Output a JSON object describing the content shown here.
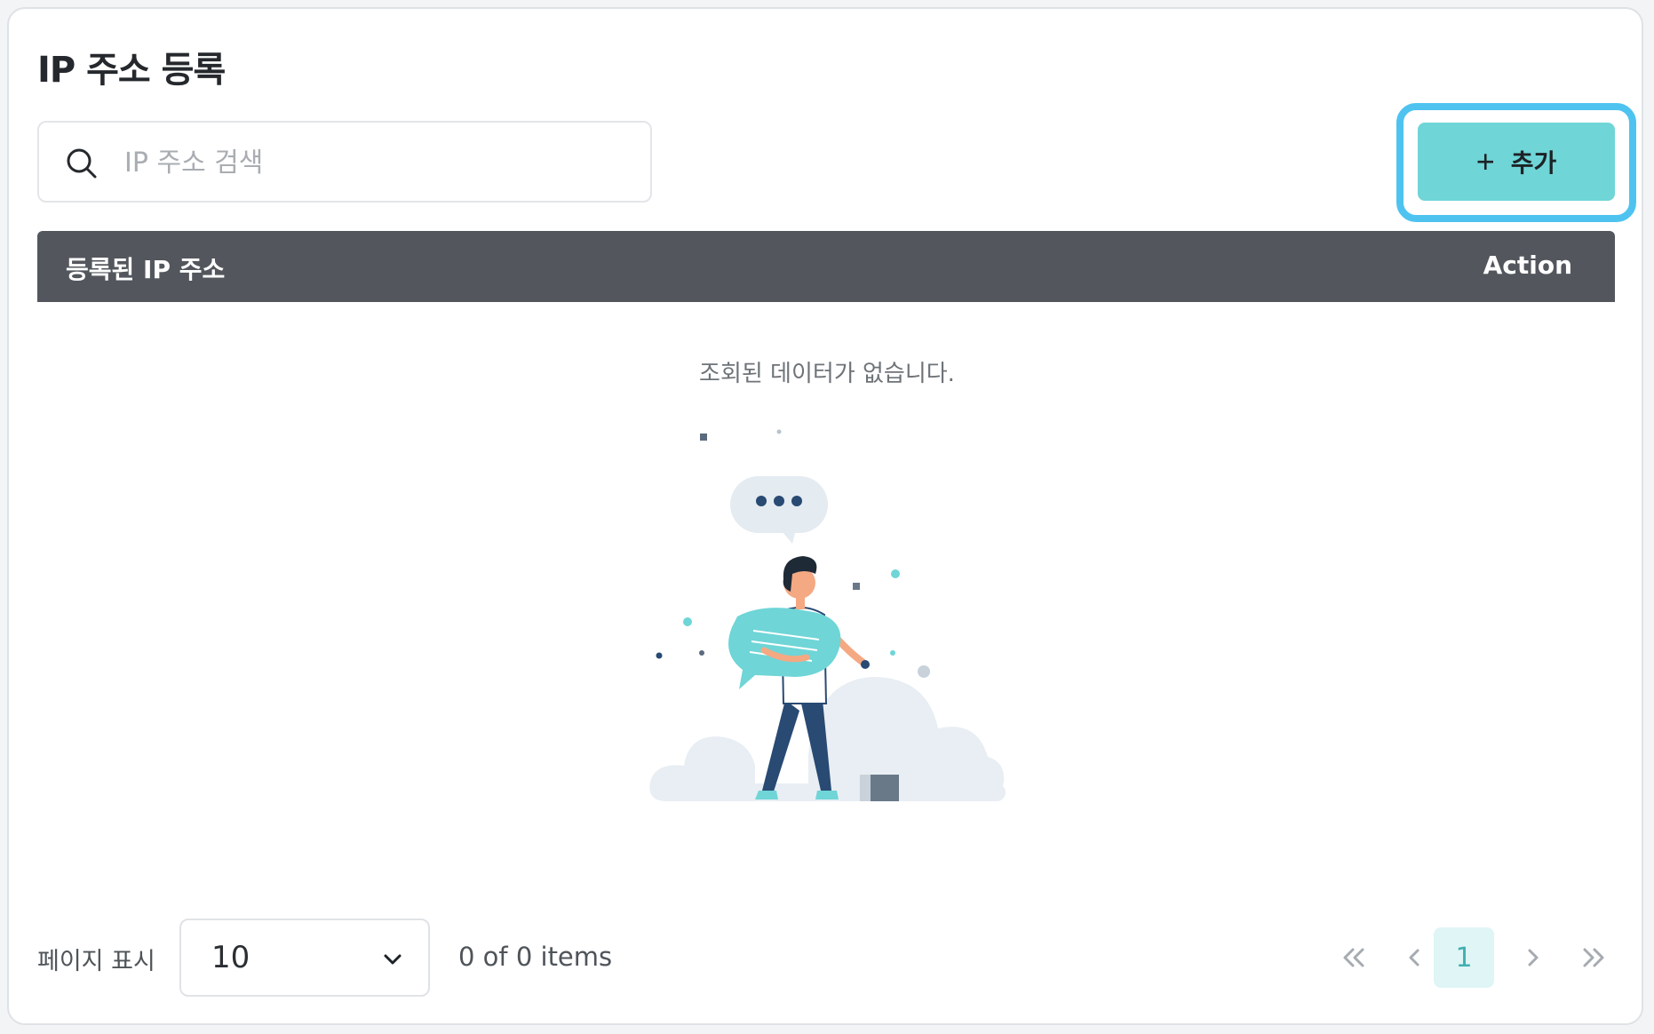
{
  "page": {
    "title": "IP 주소 등록"
  },
  "search": {
    "placeholder": "IP 주소 검색",
    "value": ""
  },
  "toolbar": {
    "add_label": "추가",
    "add_icon": "plus-icon"
  },
  "table": {
    "columns": [
      "등록된 IP 주소",
      "Action"
    ],
    "rows": [],
    "empty_message": "조회된 데이터가 없습니다."
  },
  "footer": {
    "page_size_label": "페이지 표시",
    "page_size_value": "10",
    "items_summary": "0 of 0 items"
  },
  "pagination": {
    "current_page": "1",
    "icons": [
      "double-chevron-left-icon",
      "chevron-left-icon",
      "chevron-right-icon",
      "double-chevron-right-icon"
    ]
  },
  "colors": {
    "accent": "#6fd5d7",
    "focus_ring": "#4fc3f0",
    "header_bg": "#53575d",
    "current_page_bg": "#dff5f6"
  }
}
